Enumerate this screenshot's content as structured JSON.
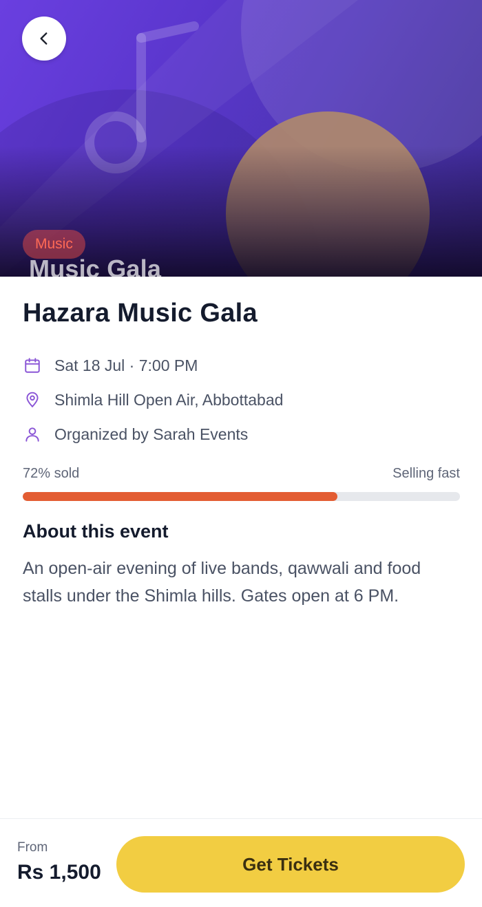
{
  "hero": {
    "category_badge": "Music",
    "overlay_title": "Music Gala",
    "back_icon": "chevron-left-icon",
    "colors": {
      "gradient_start": "#6a3fe0",
      "gradient_end": "#3d2a92",
      "circle": "#b08a6a"
    }
  },
  "event": {
    "title": "Hazara Music Gala",
    "date_time": "Sat 18 Jul · 7:00 PM",
    "venue": "Shimla Hill Open Air, Abbottabad",
    "organizer": "Organized by Sarah Events",
    "icons": {
      "date": "calendar-icon",
      "venue": "location-pin-icon",
      "organizer": "user-icon"
    },
    "accent_color": "#8a55d6"
  },
  "sales": {
    "sold_label": "72% sold",
    "status_label": "Selling fast",
    "sold_fraction": 0.72,
    "bar_color": "#e35d33"
  },
  "about": {
    "heading": "About this event",
    "body": "An open-air evening of live bands, qawwali and food stalls under the Shimla hills. Gates open at 6 PM."
  },
  "footer": {
    "from_label": "From",
    "price": "Rs 1,500",
    "cta_label": "Get Tickets",
    "cta_color": "#f2cd42"
  }
}
